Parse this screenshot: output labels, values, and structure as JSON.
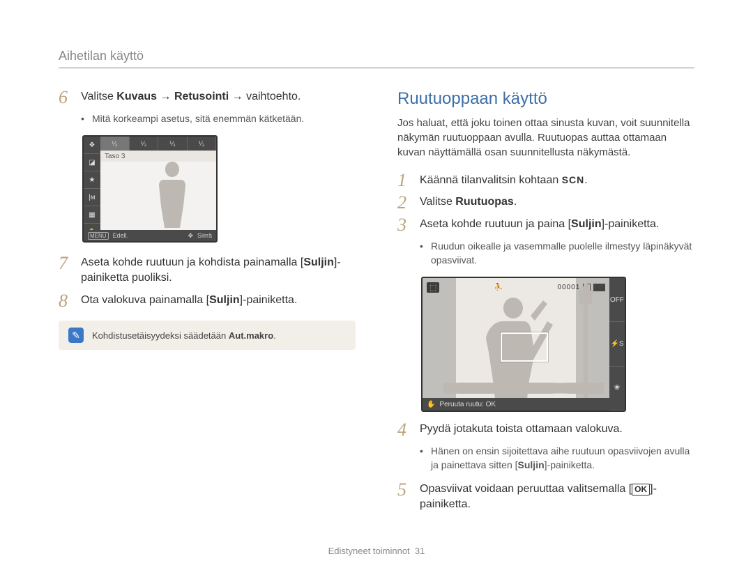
{
  "header": {
    "title": "Aihetilan käyttö"
  },
  "left": {
    "step6": {
      "num": "6",
      "pre": "Valitse ",
      "b1": "Kuvaus",
      "arrow1": " → ",
      "b2": "Retusointi",
      "arrow2": " → ",
      "post": "vaihtoehto."
    },
    "step6_sub": "Mitä korkeampi asetus, sitä enemmän kätketään.",
    "thumb": {
      "status": "Taso 3",
      "menu_icon": "MENU",
      "back": "Edell.",
      "move_icon": "✥",
      "move": "Siirrä",
      "tracks": [
        "⅟₃",
        "⅟₃",
        "⅟₃",
        "⅟₃"
      ]
    },
    "step7": {
      "num": "7",
      "text_a": "Aseta kohde ruutuun ja kohdista painamalla [",
      "text_b": "Suljin",
      "text_c": "]-painiketta puoliksi."
    },
    "step8": {
      "num": "8",
      "text_a": "Ota valokuva painamalla [",
      "text_b": "Suljin",
      "text_c": "]-painiketta."
    },
    "note": {
      "text_a": "Kohdistusetäisyydeksi säädetään ",
      "text_b": "Aut.makro",
      "text_c": "."
    }
  },
  "right": {
    "title": "Ruutuoppaan käyttö",
    "intro": "Jos haluat, että joku toinen ottaa sinusta kuvan, voit suunnitella näkymän ruutuoppaan avulla. Ruutuopas auttaa ottamaan kuvan näyttämällä osan suunnitellusta näkymästä.",
    "step1": {
      "num": "1",
      "text_a": "Käännä tilanvalitsin kohtaan ",
      "scn": "SCN",
      "text_b": "."
    },
    "step2": {
      "num": "2",
      "text_a": "Valitse ",
      "text_b": "Ruutuopas",
      "text_c": "."
    },
    "step3": {
      "num": "3",
      "text_a": "Aseta kohde ruutuun ja paina [",
      "text_b": "Suljin",
      "text_c": "]-painiketta."
    },
    "step3_sub": "Ruudun oikealle ja vasemmalle puolelle ilmestyy läpinäkyvät opasviivat.",
    "thumb2": {
      "top_left": "⬚",
      "person": "⛹",
      "counter": "00001",
      "sd": "▯",
      "battery": "▮▮▮",
      "bottom_icon": "✋",
      "bottom_text": "Peruuta ruutu: OK",
      "side_icons": [
        "OFF",
        "⚡S",
        "❀"
      ]
    },
    "step4": {
      "num": "4",
      "text": "Pyydä jotakuta toista ottamaan valokuva."
    },
    "step4_sub_a": "Hänen on ensin sijoitettava aihe ruutuun opasviivojen avulla ja painettava sitten [",
    "step4_sub_b": "Suljin",
    "step4_sub_c": "]-painiketta.",
    "step5": {
      "num": "5",
      "text_a": "Opasviivat voidaan peruuttaa valitsemalla [",
      "ok": "OK",
      "text_b": "]-painiketta."
    }
  },
  "footer": {
    "section": "Edistyneet toiminnot",
    "page": "31"
  }
}
